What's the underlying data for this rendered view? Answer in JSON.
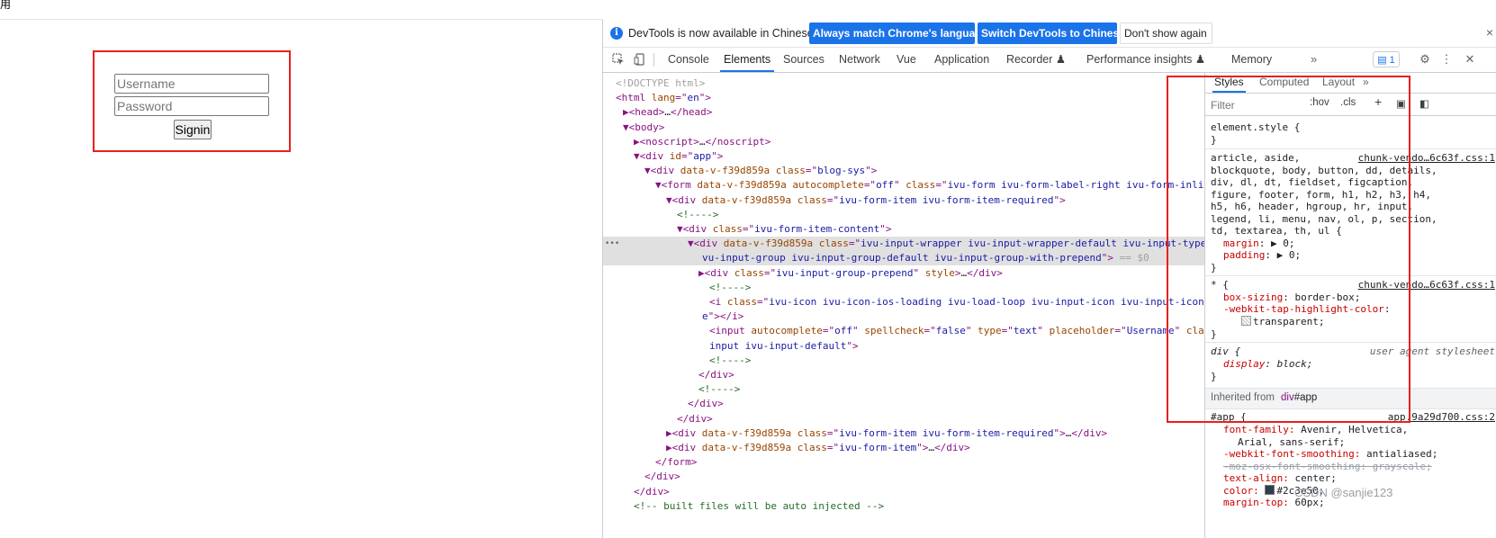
{
  "page": {
    "top_char": "用",
    "username_placeholder": "Username",
    "password_placeholder": "Password",
    "signin_label": "Signin"
  },
  "infobar": {
    "icon": "info-icon",
    "text": "DevTools is now available in Chinese!",
    "match_button": "Always match Chrome's language",
    "switch_button": "Switch DevTools to Chinese",
    "dont_show_button": "Don't show again",
    "close": "×"
  },
  "tabs": {
    "items": [
      "Console",
      "Elements",
      "Sources",
      "Network",
      "Vue",
      "Application",
      "Recorder ♟",
      "Performance insights ♟",
      "Memory"
    ],
    "active": "Elements",
    "more": "»",
    "issues_badge": "1"
  },
  "dom_lines": [
    [
      "gr:<!DOCTYPE html>"
    ],
    [
      "tw:<html ",
      "an:lang",
      "tw:=\"",
      "av:en",
      "tw:\">"
    ],
    [
      "tw:▶<head>",
      "tx:…",
      "tw:</head>"
    ],
    [
      "tw:▼<body>"
    ],
    [
      "tw:▶<noscript>",
      "tx:…",
      "tw:</noscript>"
    ],
    [
      "tw:▼<div ",
      "an:id",
      "tw:=\"",
      "av:app",
      "tw:\">"
    ],
    [
      "tw:▼<div ",
      "an:data-v-f39d859a ",
      "an:class",
      "tw:=\"",
      "av:blog-sys",
      "tw:\">"
    ],
    [
      "tw:▼<form ",
      "an:data-v-f39d859a ",
      "an:autocomplete",
      "tw:=\"",
      "av:off",
      "tw:\" ",
      "an:class",
      "tw:=\"",
      "av:ivu-form ivu-form-label-right ivu-form-inline",
      "tw:\">"
    ],
    [
      "tw:▼<div ",
      "an:data-v-f39d859a ",
      "an:class",
      "tw:=\"",
      "av:ivu-form-item ivu-form-item-required",
      "tw:\">"
    ],
    [
      "cm:<!---->"
    ],
    [
      "tw:▼<div ",
      "an:class",
      "tw:=\"",
      "av:ivu-form-item-content",
      "tw:\">"
    ],
    [
      "tw:▼<div ",
      "an:data-v-f39d859a ",
      "an:class",
      "tw:=\"",
      "av:ivu-input-wrapper ivu-input-wrapper-default ivu-input-type-text i"
    ],
    [
      "av:vu-input-group ivu-input-group-default ivu-input-group-with-prepend",
      "tw:\"> ",
      "gr:== $0"
    ],
    [
      "tw:▶<div ",
      "an:class",
      "tw:=\"",
      "av:ivu-input-group-prepend",
      "tw:\" ",
      "an:style",
      "tw:>",
      "tx:…",
      "tw:</div>"
    ],
    [
      "cm:<!---->"
    ],
    [
      "tw:<i ",
      "an:class",
      "tw:=\"",
      "av:ivu-icon ivu-icon-ios-loading ivu-load-loop ivu-input-icon ivu-input-icon-validat"
    ],
    [
      "av:e",
      "tw:\"></i>"
    ],
    [
      "tw:<input ",
      "an:autocomplete",
      "tw:=\"",
      "av:off",
      "tw:\" ",
      "an:spellcheck",
      "tw:=\"",
      "av:false",
      "tw:\" ",
      "an:type",
      "tw:=\"",
      "av:text",
      "tw:\" ",
      "an:placeholder",
      "tw:=\"",
      "av:Username",
      "tw:\" ",
      "an:class",
      "tw:=\"",
      "av:ivu-"
    ],
    [
      "av:input ivu-input-default",
      "tw:\">"
    ],
    [
      "cm:<!---->"
    ],
    [
      "tw:</div>"
    ],
    [
      "cm:<!---->"
    ],
    [
      "tw:</div>"
    ],
    [
      "tw:</div>"
    ],
    [
      "tw:▶<div ",
      "an:data-v-f39d859a ",
      "an:class",
      "tw:=\"",
      "av:ivu-form-item ivu-form-item-required",
      "tw:\">",
      "tx:…",
      "tw:</div>"
    ],
    [
      "tw:▶<div ",
      "an:data-v-f39d859a ",
      "an:class",
      "tw:=\"",
      "av:ivu-form-item",
      "tw:\">",
      "tx:…",
      "tw:</div>"
    ],
    [
      "tw:</form>"
    ],
    [
      "tw:</div>"
    ],
    [
      "tw:</div>"
    ],
    [
      "cm:<!-- built files will be auto injected -->"
    ]
  ],
  "selected_dom_lines": [
    11,
    12
  ],
  "dom_ellipsis": "•••",
  "styles": {
    "tabs": [
      "Styles",
      "Computed",
      "Layout",
      "»"
    ],
    "filter_placeholder": "Filter",
    "hov": ":hov",
    "cls": ".cls",
    "plus": "+",
    "element_style": "element.style {",
    "close_brace": "}",
    "rule1_selectors": [
      "article, aside,",
      "blockquote, body, button, dd, details,",
      "div, dl, dt, fieldset, figcaption,",
      "figure, footer, form, h1, h2, h3, h4,",
      "h5, h6, header, hgroup, hr, input,",
      "legend, li, menu, nav, ol, p, section,",
      "td, textarea, th, ul {"
    ],
    "rule1_source": "chunk-vendo…6c63f.css:1",
    "rule1_props": [
      {
        "name": "margin",
        "value": "▶ 0;"
      },
      {
        "name": "padding",
        "value": "▶ 0;"
      }
    ],
    "rule2_selector": "* {",
    "rule2_source": "chunk-vendo…6c63f.css:1",
    "rule2_props": [
      {
        "name": "box-sizing",
        "value": "border-box;"
      },
      {
        "name": "-webkit-tap-highlight-color",
        "value": ""
      }
    ],
    "rule2_extra": "transparent;",
    "rule3_selector": "div {",
    "rule3_source": "user agent stylesheet",
    "rule3_prop": {
      "name": "display",
      "value": "block;"
    },
    "inherited_label": "Inherited from",
    "inherited_el": "div",
    "inherited_id": "#app",
    "rule4_selector": "#app {",
    "rule4_source": "app.9a29d700.css:2",
    "rule4_lines": [
      {
        "name": "font-family",
        "value": "Avenir, Helvetica,",
        "strike": false
      },
      {
        "name": "",
        "value": "Arial, sans-serif;",
        "strike": false
      },
      {
        "name": "-webkit-font-smoothing",
        "value": "antialiased;",
        "strike": false
      },
      {
        "name": "-moz-osx-font-smoothing",
        "value": "grayscale;",
        "strike": true
      },
      {
        "name": "text-align",
        "value": "center;",
        "strike": false
      },
      {
        "name": "color",
        "value": "#2c3e50;",
        "strike": false
      },
      {
        "name": "margin-top",
        "value": "60px;",
        "strike": false
      }
    ]
  },
  "watermark": "CSDN @sanjie123",
  "colors": {
    "highlight_red": "#e8201d",
    "accent_blue": "#1a73e8"
  }
}
